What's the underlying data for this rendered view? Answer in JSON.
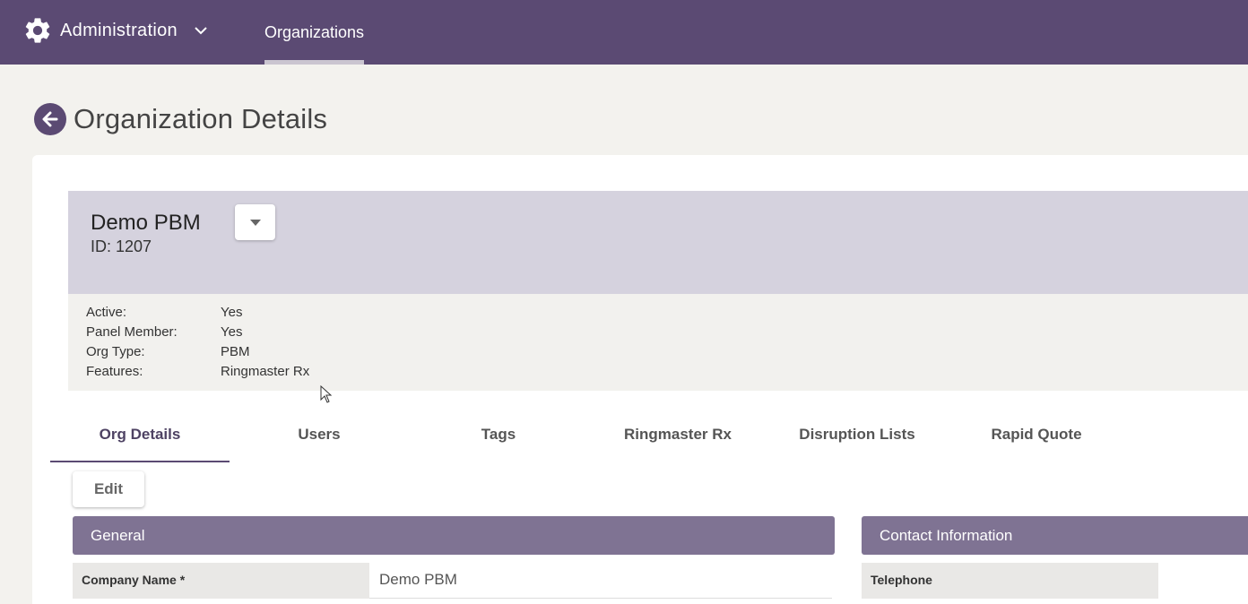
{
  "topbar": {
    "app_title": "Administration",
    "nav_tab": "Organizations",
    "background": "#5b4a73"
  },
  "page": {
    "title": "Organization Details"
  },
  "org": {
    "name": "Demo PBM",
    "id_text": "ID: 1207",
    "details": [
      {
        "label": "Active:",
        "value": "Yes"
      },
      {
        "label": "Panel Member:",
        "value": "Yes"
      },
      {
        "label": "Org Type:",
        "value": "PBM"
      },
      {
        "label": "Features:",
        "value": "Ringmaster Rx"
      }
    ]
  },
  "tabs": [
    {
      "label": "Org Details",
      "active": true
    },
    {
      "label": "Users",
      "active": false
    },
    {
      "label": "Tags",
      "active": false
    },
    {
      "label": "Ringmaster Rx",
      "active": false
    },
    {
      "label": "Disruption Lists",
      "active": false
    },
    {
      "label": "Rapid Quote",
      "active": false
    }
  ],
  "actions": {
    "edit_label": "Edit"
  },
  "sections": {
    "general": {
      "title": "General",
      "fields": [
        {
          "label": "Company Name *",
          "value": "Demo PBM"
        }
      ]
    },
    "contact": {
      "title": "Contact Information",
      "fields": [
        {
          "label": "Telephone",
          "value": ""
        }
      ]
    }
  },
  "icons": {
    "settings": "gear-icon",
    "menu": "chevron-down-icon",
    "back": "arrow-left-icon",
    "dropdown": "caret-down-icon"
  }
}
